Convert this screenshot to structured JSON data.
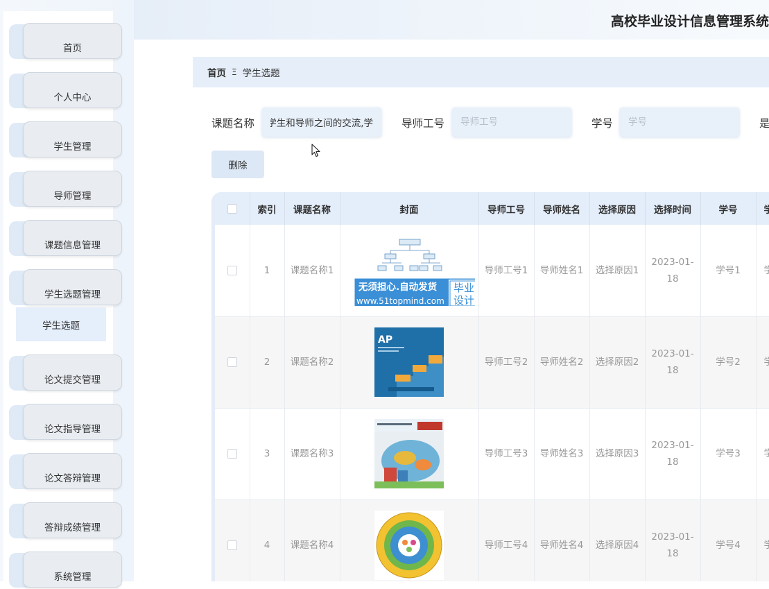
{
  "app": {
    "title": "高校毕业设计信息管理系统"
  },
  "sidebar": {
    "items": [
      {
        "label": "首页"
      },
      {
        "label": "个人中心"
      },
      {
        "label": "学生管理"
      },
      {
        "label": "导师管理"
      },
      {
        "label": "课题信息管理"
      },
      {
        "label": "学生选题管理"
      },
      {
        "label": "论文提交管理"
      },
      {
        "label": "论文指导管理"
      },
      {
        "label": "论文答辩管理"
      },
      {
        "label": "答辩成绩管理"
      },
      {
        "label": "系统管理"
      }
    ],
    "active_sub": "学生选题"
  },
  "breadcrumb": {
    "home": "首页",
    "separator": "Ξ",
    "current": "学生选题"
  },
  "search": {
    "topic_label": "课题名称",
    "topic_value": "学生和导师之间的交流,学",
    "teacher_id_label": "导师工号",
    "teacher_id_placeholder": "导师工号",
    "student_id_label": "学号",
    "student_id_placeholder": "学号",
    "more_label": "是"
  },
  "actions": {
    "delete_label": "删除"
  },
  "watermark": {
    "line1": "无须担心.自动发货",
    "line2": "www.51topmind.com",
    "badge1": "毕业",
    "badge2": "设计"
  },
  "table": {
    "headers": [
      "索引",
      "课题名称",
      "封面",
      "导师工号",
      "导师姓名",
      "选择原因",
      "选择时间",
      "学号",
      "学"
    ],
    "rows": [
      {
        "index": "1",
        "topic": "课题名称1",
        "cover": "org-chart-cover",
        "teacher_id": "导师工号1",
        "teacher_name": "导师姓名1",
        "reason": "选择原因1",
        "time": "2023-01-18",
        "student_id": "学号1",
        "next": "学"
      },
      {
        "index": "2",
        "topic": "课题名称2",
        "cover": "ap-book-cover",
        "teacher_id": "导师工号2",
        "teacher_name": "导师姓名2",
        "reason": "选择原因2",
        "time": "2023-01-18",
        "student_id": "学号2",
        "next": "学"
      },
      {
        "index": "3",
        "topic": "课题名称3",
        "cover": "math-book-cover",
        "teacher_id": "导师工号3",
        "teacher_name": "导师姓名3",
        "reason": "选择原因3",
        "time": "2023-01-18",
        "student_id": "学号3",
        "next": "学"
      },
      {
        "index": "4",
        "topic": "课题名称4",
        "cover": "circle-emblem-cover",
        "teacher_id": "导师工号4",
        "teacher_name": "导师姓名4",
        "reason": "选择原因4",
        "time": "2023-01-18",
        "student_id": "学号4",
        "next": "学"
      }
    ]
  },
  "cover_images": {
    "ap_book": {
      "title": "AP"
    }
  },
  "colors": {
    "accent": "#e4eefa",
    "sidebar_item": "#e9edf2",
    "watermark_blue": "#3b8fd6"
  }
}
